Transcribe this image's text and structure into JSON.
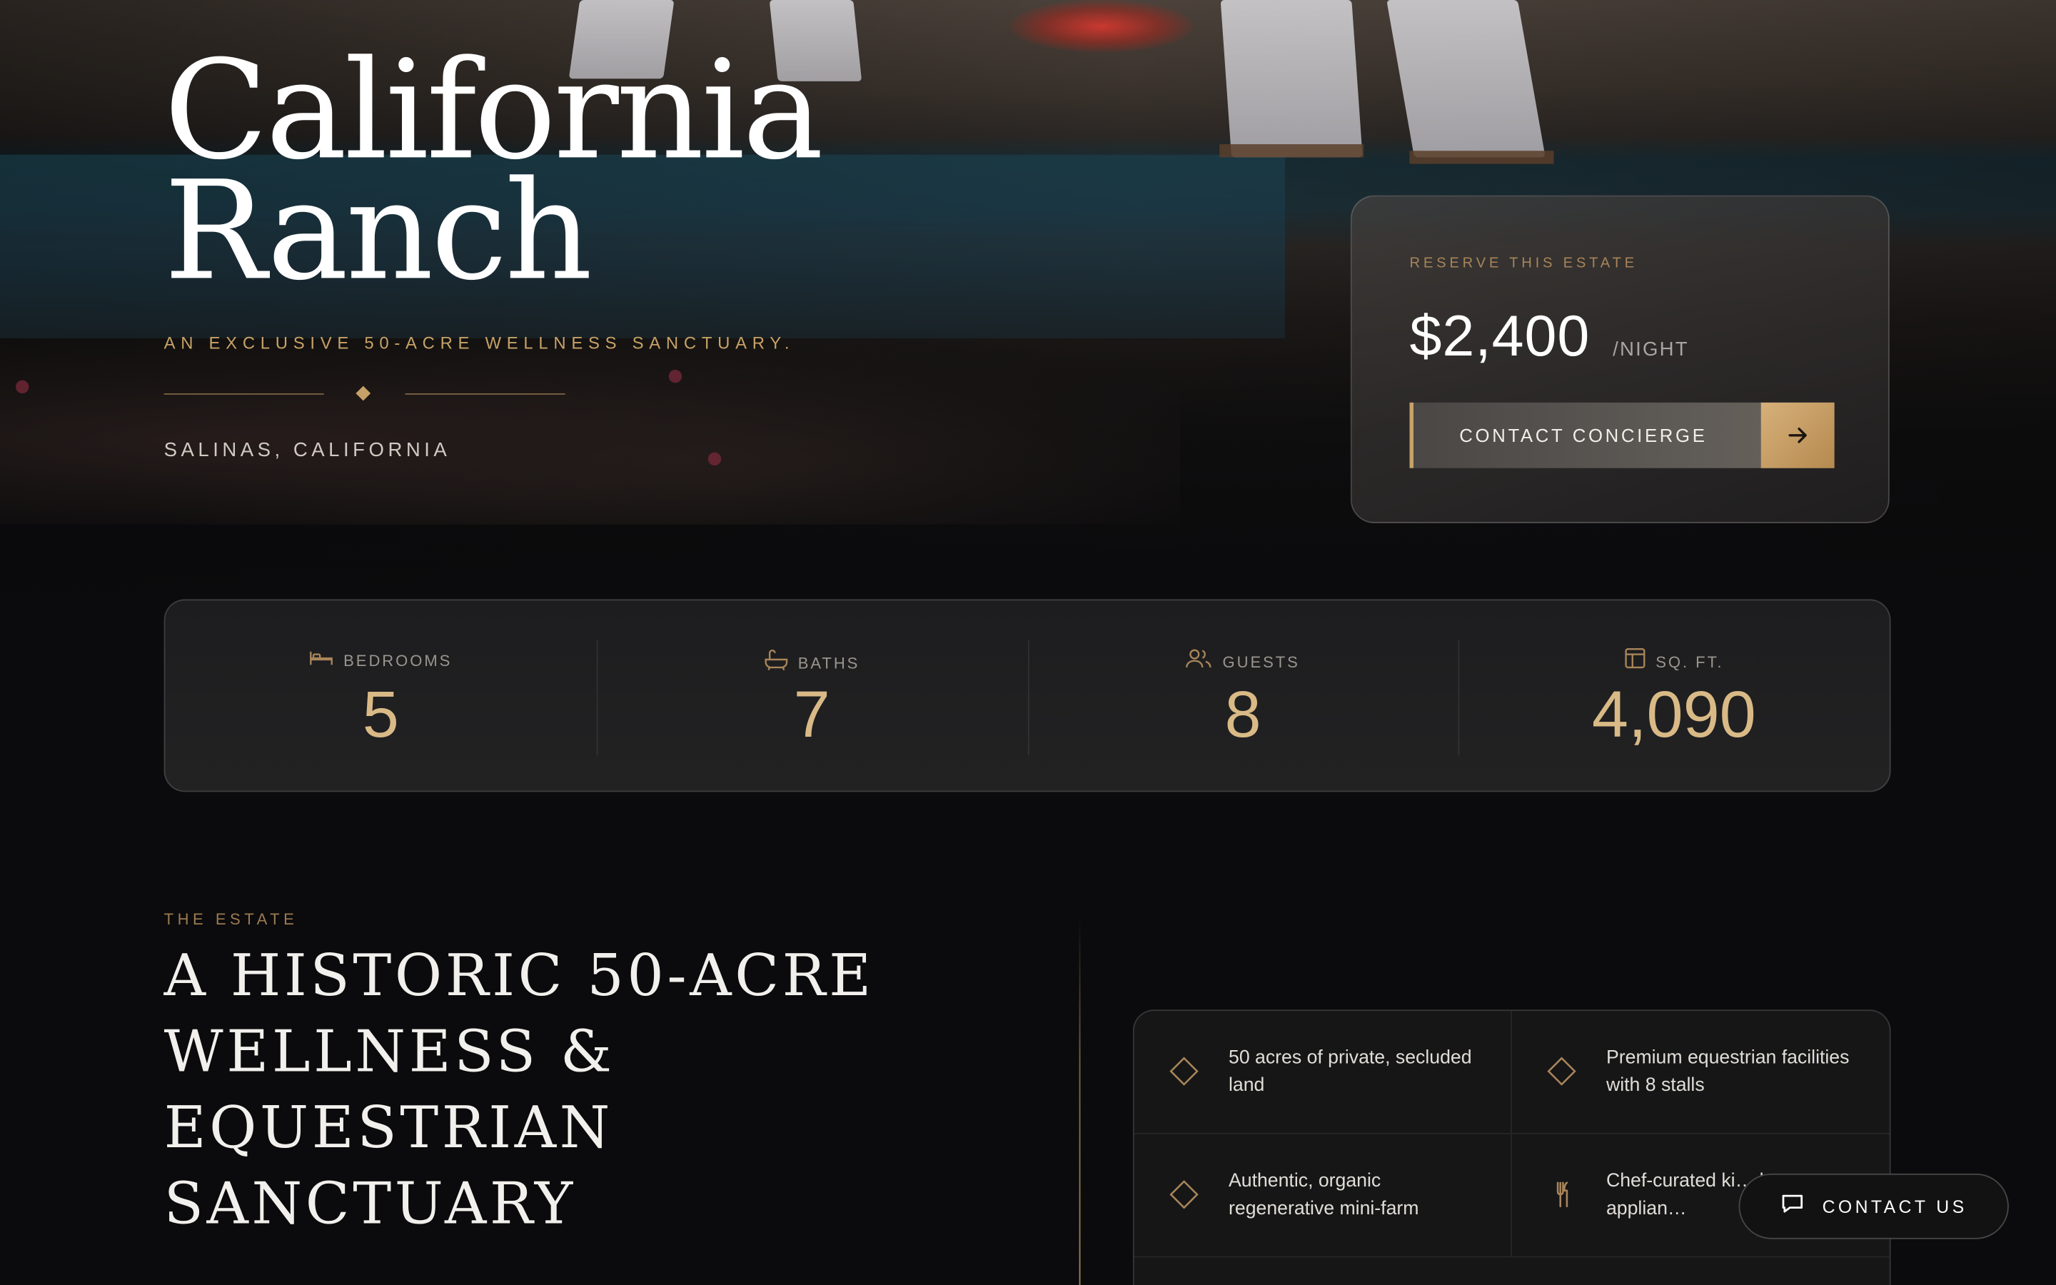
{
  "hero": {
    "title_line1": "California",
    "title_line2": "Ranch",
    "tagline": "AN EXCLUSIVE 50-ACRE WELLNESS SANCTUARY.",
    "location": "SALINAS, CALIFORNIA"
  },
  "reserve": {
    "eyebrow": "RESERVE THIS ESTATE",
    "price": "$2,400",
    "unit": "/NIGHT",
    "cta_label": "CONTACT CONCIERGE",
    "cta_icon": "arrow-right-icon"
  },
  "stats": [
    {
      "label": "BEDROOMS",
      "value": "5",
      "icon": "bed-icon"
    },
    {
      "label": "BATHS",
      "value": "7",
      "icon": "bath-icon"
    },
    {
      "label": "GUESTS",
      "value": "8",
      "icon": "users-icon"
    },
    {
      "label": "SQ. FT.",
      "value": "4,090",
      "icon": "floorplan-icon"
    }
  ],
  "estate": {
    "eyebrow": "THE ESTATE",
    "title": "A HISTORIC 50-ACRE WELLNESS & EQUESTRIAN SANCTUARY",
    "features": [
      {
        "text": "50 acres of private, secluded land",
        "icon": "diamond-icon"
      },
      {
        "text": "Premium equestrian facilities with 8 stalls",
        "icon": "diamond-icon"
      },
      {
        "text": "Authentic, organic regenerative mini-farm",
        "icon": "diamond-icon"
      },
      {
        "text": "Chef-curated ki… luxury applian…",
        "icon": "utensils-icon"
      }
    ]
  },
  "floating": {
    "contact_label": "CONTACT US",
    "contact_icon": "chat-icon"
  },
  "colors": {
    "accent_gold": "#c6a268",
    "stat_value": "#d9ba86",
    "background": "#0b0b0d"
  }
}
